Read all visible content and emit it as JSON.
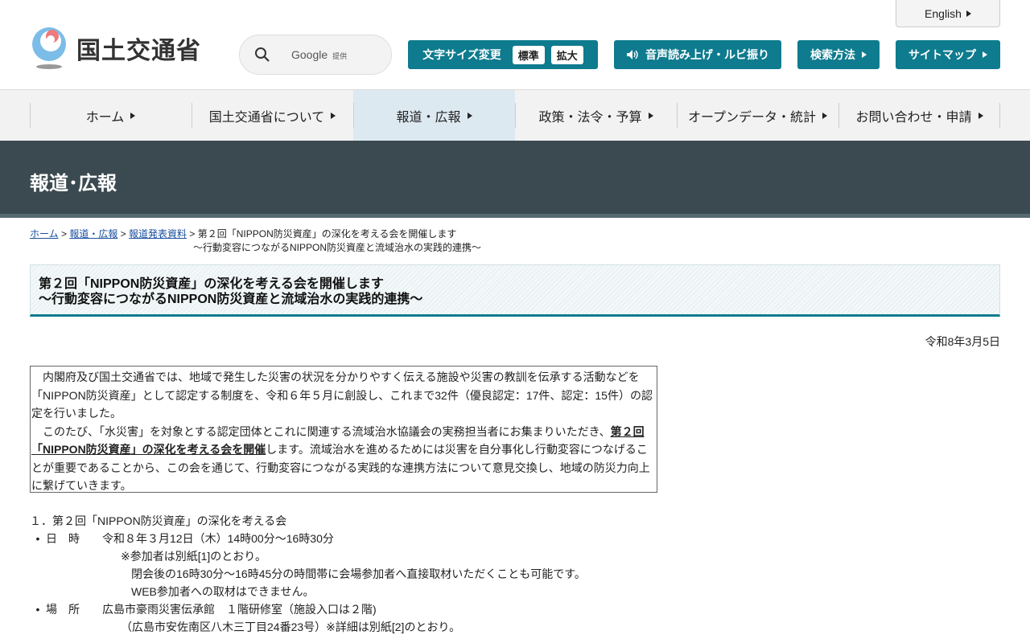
{
  "header": {
    "english": "English",
    "logo_text": "国土交通省",
    "search": {
      "brand": "Google",
      "suffix": "提供"
    },
    "font_size": {
      "label": "文字サイズ変更",
      "standard": "標準",
      "large": "拡大"
    },
    "voice": "音声読み上げ・ルビ振り",
    "search_method": "検索方法",
    "sitemap": "サイトマップ"
  },
  "nav": [
    {
      "label": "ホーム"
    },
    {
      "label": "国土交通省について"
    },
    {
      "label": "報道・広報"
    },
    {
      "label": "政策・法令・予算"
    },
    {
      "label": "オープンデータ・統計"
    },
    {
      "label": "お問い合わせ・申請"
    }
  ],
  "banner": "報道･広報",
  "breadcrumb": {
    "home": "ホーム",
    "press": "報道・広報",
    "releases": "報道発表資料",
    "current1": "第２回「NIPPON防災資産」の深化を考える会を開催します",
    "current2": "～行動変容につながるNIPPON防災資産と流域治水の実践的連携～"
  },
  "title": {
    "line1": "第２回「NIPPON防災資産」の深化を考える会を開催します",
    "line2": "～行動変容につながるNIPPON防災資産と流域治水の実践的連携～"
  },
  "date": "令和8年3月5日",
  "lead": {
    "p1": "　内閣府及び国土交通省では、地域で発生した災害の状況を分かりやすく伝える施設や災害の教訓を伝承する活動などを「NIPPON防災資産」として認定する制度を、令和６年５月に創設し、これまで32件（優良認定：17件、認定：15件）の認定を行いました。",
    "p2a": "　このたび、「水災害」を対象とする認定団体とこれに関連する流域治水協議会の実務担当者にお集まりいただき、",
    "p2b": "第２回「NIPPON防災資産」の深化を考える会を開催",
    "p2c": "します。流域治水を進めるためには災害を自分事化し行動変容につなげることが重要であることから、この会を通じて、行動変容につながる実践的な連携方法について意見交換し、地域の防災力向上に繋げていきます。"
  },
  "details": {
    "heading": "１．第２回「NIPPON防災資産」の深化を考える会",
    "bullet": "•",
    "datetime_label": "日　時",
    "datetime": "令和８年３月12日（木）14時00分～16時30分",
    "note1": "※参加者は別紙[1]のとおり。",
    "note2": "閉会後の16時30分～16時45分の時間帯に会場参加者へ直接取材いただくことも可能です。",
    "note3": "WEB参加者への取材はできません。",
    "place_label": "場　所",
    "place": "広島市豪雨災害伝承館　１階研修室（施設入口は２階)",
    "address": "（広島市安佐南区八木三丁目24番23号）※詳細は別紙[2]のとおり。"
  }
}
